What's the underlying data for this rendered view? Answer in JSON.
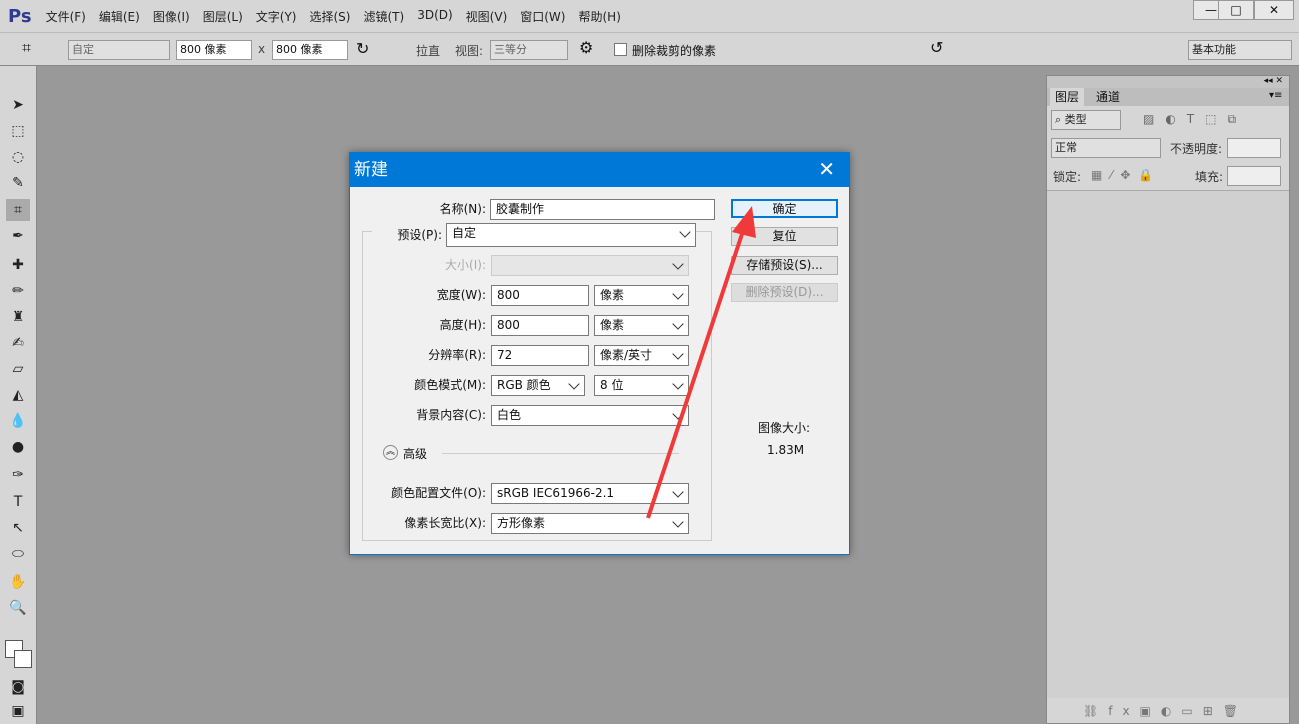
{
  "app": {
    "logo": "Ps",
    "menu": [
      "文件(F)",
      "编辑(E)",
      "图像(I)",
      "图层(L)",
      "文字(Y)",
      "选择(S)",
      "滤镜(T)",
      "3D(D)",
      "视图(V)",
      "窗口(W)",
      "帮助(H)"
    ],
    "window_controls": [
      "—",
      "□",
      "✕"
    ]
  },
  "options": {
    "ratio": "自定",
    "width": "800 像素",
    "x": "x",
    "height": "800 像素",
    "straighten": "拉直",
    "view_label": "视图:",
    "view": "三等分",
    "delete_cropped": "删除裁剪的像素",
    "workspace": "基本功能"
  },
  "panel": {
    "tabs": [
      "图层",
      "通道"
    ],
    "filter": "类型",
    "blend": "正常",
    "opacity_label": "不透明度:",
    "lock_label": "锁定:",
    "fill_label": "填充:"
  },
  "dialog": {
    "title": "新建",
    "name_label": "名称(N):",
    "name": "胶囊制作",
    "preset_label": "预设(P):",
    "preset": "自定",
    "size_label": "大小(I):",
    "width_label": "宽度(W):",
    "width": "800",
    "width_unit": "像素",
    "height_label": "高度(H):",
    "height": "800",
    "height_unit": "像素",
    "res_label": "分辨率(R):",
    "res": "72",
    "res_unit": "像素/英寸",
    "mode_label": "颜色模式(M):",
    "mode": "RGB 颜色",
    "bits": "8 位",
    "bg_label": "背景内容(C):",
    "bg": "白色",
    "advanced": "高级",
    "profile_label": "颜色配置文件(O):",
    "profile": "sRGB IEC61966-2.1",
    "aspect_label": "像素长宽比(X):",
    "aspect": "方形像素",
    "ok": "确定",
    "reset": "复位",
    "save_preset": "存储预设(S)...",
    "delete_preset": "删除预设(D)...",
    "image_size_label": "图像大小:",
    "image_size": "1.83M"
  },
  "colors": {
    "accent": "#0078d7",
    "arrow": "#f03a3a"
  }
}
